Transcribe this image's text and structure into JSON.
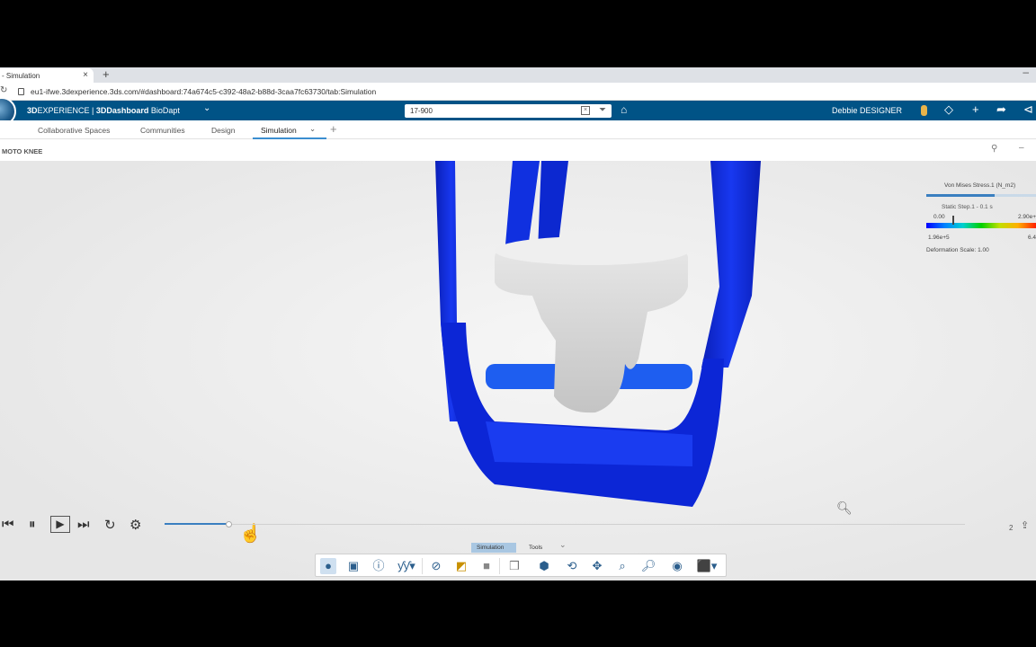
{
  "browser": {
    "tab_title": "- Simulation",
    "tab_close": "×",
    "new_tab": "+",
    "minimize": "–",
    "url": "eu1-ifwe.3dexperience.3ds.com/#dashboard:74a674c5-c392-48a2-b88d-3caa7fc63730/tab:Simulation"
  },
  "header": {
    "brand_bold": "3D",
    "brand_text": "EXPERIENCE | ",
    "dashboard": "3DDashboard",
    "app": "BioDapt",
    "search_value": "17-900",
    "user": "Debbie DESIGNER"
  },
  "tabs": [
    {
      "label": "Collaborative Spaces"
    },
    {
      "label": "Communities"
    },
    {
      "label": "Design"
    },
    {
      "label": "Simulation",
      "active": true
    }
  ],
  "widget": {
    "title": "MOTO KNEE"
  },
  "legend": {
    "title": "Von Mises Stress.1 (N_m2)",
    "step": "Static Step.1 - 0.1 s",
    "min_label": "0.00",
    "max_label": "2.90e+",
    "low_value": "1.96e+5",
    "high_value": "6.4",
    "deformation": "Deformation Scale: 1.00",
    "colors": [
      "#0000ff",
      "#0080ff",
      "#00d0d0",
      "#00d000",
      "#c0e000",
      "#ffb000",
      "#ff2000"
    ]
  },
  "playback": {
    "progress": 0.08,
    "page": "2"
  },
  "actionbar": {
    "tabs": [
      {
        "label": "Simulation",
        "active": true
      },
      {
        "label": "Tools"
      }
    ],
    "icons": [
      "sphere-icon",
      "model-icon",
      "info-icon",
      "function-icon",
      "hide-icon",
      "colormap-icon",
      "gray-box-icon",
      "cube-icon",
      "mesh-icon",
      "rotate-icon",
      "pan-icon",
      "zoom-area-icon",
      "zoom-icon",
      "look-at-icon",
      "view-cube-icon"
    ]
  },
  "colors": {
    "header_bg": "#005386",
    "accent": "#3b8ed0",
    "model_blue": "#1030e0",
    "part_gray": "#d8d8d8"
  }
}
